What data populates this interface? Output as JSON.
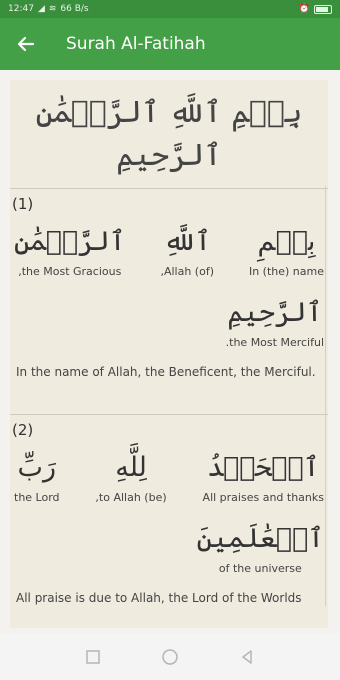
{
  "status": {
    "time": "12:47",
    "speed": "66 B/s",
    "battery": "73"
  },
  "app_bar": {
    "title": "Surah Al-Fatihah",
    "back_icon": "arrow-back-icon"
  },
  "bismillah": {
    "line1": "بِسۡمِ ٱللَّهِ ٱلرَّحۡمَٰنِ",
    "line2": "ٱلرَّحِيمِ"
  },
  "ayahs": [
    {
      "number": "(1)",
      "words_row1": [
        {
          "ar": "بِسۡمِ",
          "tr": "In (the) name"
        },
        {
          "ar": "ٱللَّهِ",
          "tr": "(of) Allah,"
        },
        {
          "ar": "ٱلرَّحۡمَٰنِ",
          "tr": "the Most Gracious,"
        }
      ],
      "words_row2": [
        {
          "ar": "ٱلرَّحِيمِ",
          "tr": "the Most Merciful."
        }
      ],
      "translation": "In the name of Allah, the Beneficent, the Merciful."
    },
    {
      "number": "(2)",
      "words_row1": [
        {
          "ar": "ٱلۡحَمۡدُ",
          "tr": "All praises and thanks"
        },
        {
          "ar": "لِلَّهِ",
          "tr": "(be) to Allah,"
        },
        {
          "ar": "رَبِّ",
          "tr": "the Lord"
        }
      ],
      "words_row2": [
        {
          "ar": "ٱلۡعَٰلَمِينَ",
          "tr": "of the universe"
        }
      ],
      "translation": "All praise is due to Allah, the Lord of the Worlds"
    }
  ],
  "nav": {
    "recents_icon": "square-recents-icon",
    "home_icon": "circle-home-icon",
    "back_icon": "triangle-back-icon"
  },
  "colors": {
    "status_bar": "#3a8f3c",
    "app_bar": "#43a047",
    "content_bg": "#efebdf"
  }
}
